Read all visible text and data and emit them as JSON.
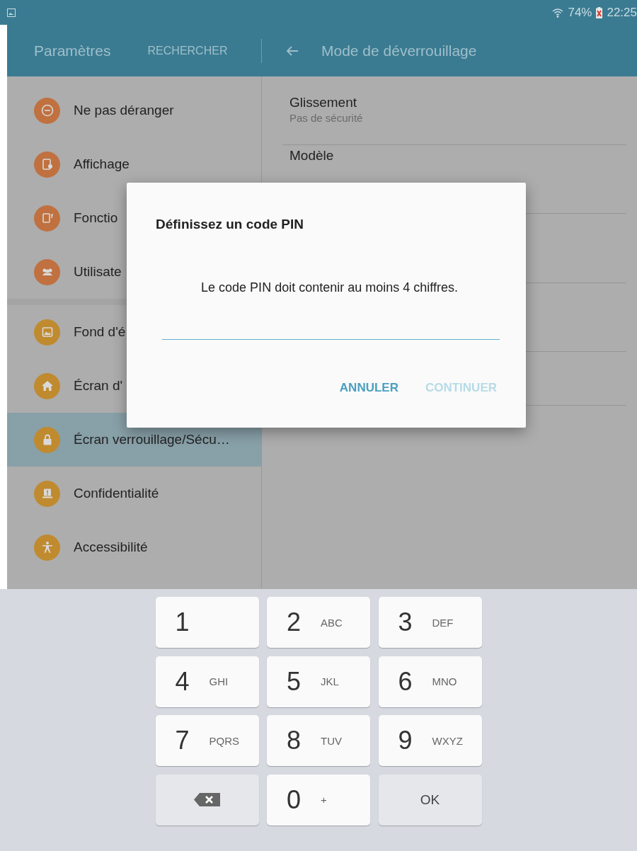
{
  "status_bar": {
    "battery": "74%",
    "time": "22:25"
  },
  "app_bar": {
    "title": "Paramètres",
    "search_button": "RECHERCHER",
    "page_title": "Mode de déverrouillage"
  },
  "sidebar": {
    "groups": [
      {
        "items": [
          {
            "label": "Ne pas déranger",
            "color": "#c0713f",
            "selected": false
          },
          {
            "label": "Affichage",
            "color": "#c0713f",
            "selected": false
          },
          {
            "label": "Fonctio",
            "color": "#c0713f",
            "selected": false
          },
          {
            "label": "Utilisate",
            "color": "#c0713f",
            "selected": false
          }
        ]
      },
      {
        "items": [
          {
            "label": "Fond d'é",
            "color": "#c08a2f",
            "selected": false
          },
          {
            "label": "Écran d'",
            "color": "#c08a2f",
            "selected": false
          },
          {
            "label": "Écran verrouillage/Sécu…",
            "color": "#c08a2f",
            "selected": true
          },
          {
            "label": "Confidentialité",
            "color": "#c08a2f",
            "selected": false
          },
          {
            "label": "Accessibilité",
            "color": "#c08a2f",
            "selected": false
          }
        ]
      }
    ]
  },
  "options": [
    {
      "title": "Glissement",
      "subtitle": "Pas de sécurité"
    },
    {
      "title": "Modèle"
    }
  ],
  "dialog": {
    "title": "Définissez un code PIN",
    "message": "Le code PIN doit contenir au moins 4 chiffres.",
    "buttons": [
      {
        "label": "ANNULER",
        "disabled": false
      },
      {
        "label": "CONTINUER",
        "disabled": true
      }
    ]
  },
  "keypad": [
    {
      "kind": "digit",
      "digit": "1"
    },
    {
      "kind": "digit",
      "digit": "2",
      "letters": "ABC"
    },
    {
      "kind": "digit",
      "digit": "3",
      "letters": "DEF"
    },
    {
      "kind": "digit",
      "digit": "4",
      "letters": "GHI"
    },
    {
      "kind": "digit",
      "digit": "5",
      "letters": "JKL"
    },
    {
      "kind": "digit",
      "digit": "6",
      "letters": "MNO"
    },
    {
      "kind": "digit",
      "digit": "7",
      "letters": "PQRS"
    },
    {
      "kind": "digit",
      "digit": "8",
      "letters": "TUV"
    },
    {
      "kind": "digit",
      "digit": "9",
      "letters": "WXYZ"
    },
    {
      "kind": "backspace"
    },
    {
      "kind": "digit",
      "digit": "0",
      "letters": "+"
    },
    {
      "kind": "ok",
      "label": "OK"
    }
  ]
}
